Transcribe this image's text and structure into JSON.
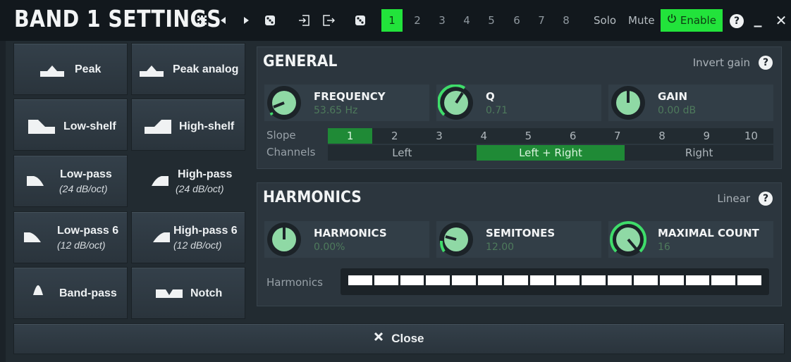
{
  "window": {
    "title": "BAND 1 SETTINGS",
    "bands": [
      "1",
      "2",
      "3",
      "4",
      "5",
      "6",
      "7",
      "8"
    ],
    "active_band": "1",
    "solo_label": "Solo",
    "mute_label": "Mute",
    "enable_label": "Enable",
    "help_label": "?",
    "minimize_label": "_",
    "close_label": "✕"
  },
  "filters": {
    "peak": "Peak",
    "peak_analog": "Peak analog",
    "low_shelf": "Low-shelf",
    "high_shelf": "High-shelf",
    "low_pass": "Low-pass",
    "low_pass_sub": "(24 dB/oct)",
    "high_pass": "High-pass",
    "high_pass_sub": "(24 dB/oct)",
    "low_pass6": "Low-pass 6",
    "low_pass6_sub": "(12 dB/oct)",
    "high_pass6": "High-pass 6",
    "high_pass6_sub": "(12 dB/oct)",
    "band_pass": "Band-pass",
    "notch": "Notch"
  },
  "general": {
    "title": "GENERAL",
    "invert_gain_label": "Invert gain",
    "frequency": {
      "name": "FREQUENCY",
      "value": "53.65 Hz"
    },
    "q": {
      "name": "Q",
      "value": "0.71"
    },
    "gain": {
      "name": "GAIN",
      "value": "0.00 dB"
    },
    "slope_label": "Slope",
    "slopes": [
      "1",
      "2",
      "3",
      "4",
      "5",
      "6",
      "7",
      "8",
      "9",
      "10"
    ],
    "active_slope": "1",
    "channels_label": "Channels",
    "channels": [
      "Left",
      "Left + Right",
      "Right"
    ],
    "active_channel": "Left + Right"
  },
  "harmonics": {
    "title": "HARMONICS",
    "linear_label": "Linear",
    "harmonics": {
      "name": "HARMONICS",
      "value": "0.00%"
    },
    "semitones": {
      "name": "SEMITONES",
      "value": "12.00"
    },
    "maximal_count": {
      "name": "MAXIMAL COUNT",
      "value": "16"
    },
    "strip_label": "Harmonics",
    "strip_count": 16
  },
  "footer": {
    "close_label": "Close"
  },
  "colors": {
    "accent": "#22e33b",
    "active_segment": "#1f8a36",
    "knob_fill": "#8fd9a5"
  }
}
